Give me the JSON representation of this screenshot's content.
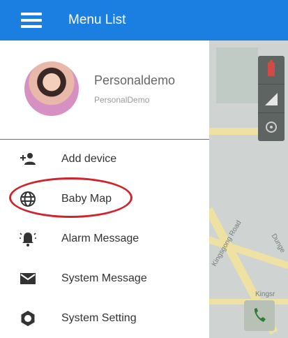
{
  "header": {
    "title": "Menu List"
  },
  "profile": {
    "name": "Personaldemo",
    "subtitle": "PersonalDemo"
  },
  "menu": {
    "items": [
      {
        "label": "Add device",
        "icon": "add-person-icon"
      },
      {
        "label": "Baby Map",
        "icon": "globe-icon"
      },
      {
        "label": "Alarm Message",
        "icon": "alarm-bell-icon"
      },
      {
        "label": "System Message",
        "icon": "envelope-icon"
      },
      {
        "label": "System Setting",
        "icon": "settings-hexagon-icon"
      }
    ]
  },
  "map": {
    "streets": [
      "Kingsgong Road",
      "Dunge",
      "Kingsr"
    ]
  },
  "colors": {
    "header": "#1a7fe0",
    "highlight_circle": "#d0242a",
    "map_overlay": "#cfd3d2"
  }
}
